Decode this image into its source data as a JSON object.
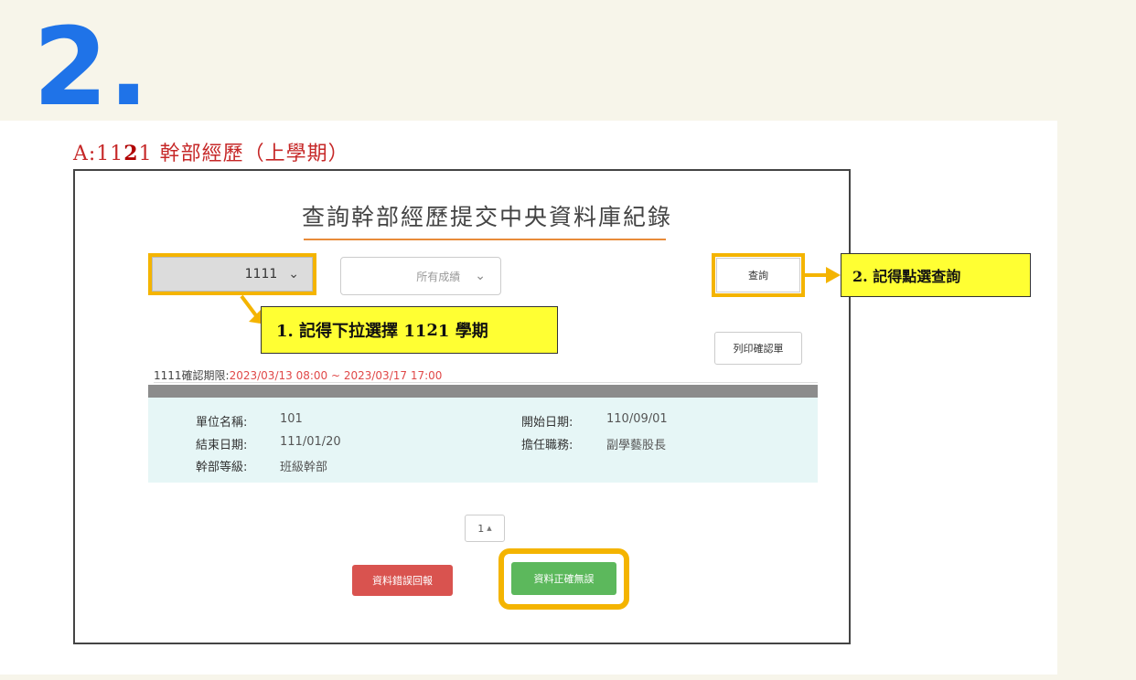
{
  "step_number": "2.",
  "section_heading": {
    "prefix": "A:11",
    "highlight": "2",
    "suffix": "1 幹部經歷（上學期）"
  },
  "page": {
    "title": "查詢幹部經歷提交中央資料庫紀錄"
  },
  "filters": {
    "semester_value": "1111",
    "grade_value": "所有成績"
  },
  "buttons": {
    "query": "查詢",
    "print": "列印確認單",
    "report_error": "資料錯誤回報",
    "confirm_correct": "資料正確無誤"
  },
  "callouts": {
    "semester": {
      "prefix": "1. 記得下拉選擇 11",
      "highlight": "2",
      "suffix": "1 學期"
    },
    "query": "2. 記得點選查詢"
  },
  "period": {
    "label": "1111確認期限:",
    "range": "2023/03/13 08:00 ~ 2023/03/17 17:00"
  },
  "record": {
    "unit_label": "單位名稱:",
    "unit_value": "101",
    "start_label": "開始日期:",
    "start_value": "110/09/01",
    "end_label": "結束日期:",
    "end_value": "111/01/20",
    "role_label": "擔任職務:",
    "role_value": "副學藝股長",
    "level_label": "幹部等級:",
    "level_value": "班級幹部"
  },
  "pagination": {
    "current_page": "1"
  },
  "colors": {
    "step_number": "#1f73e8",
    "highlight_border": "#f4b400",
    "callout_fill": "#ffff33",
    "heading_red": "#c62828",
    "report_button": "#d9534f",
    "confirm_button": "#5cb85c"
  }
}
